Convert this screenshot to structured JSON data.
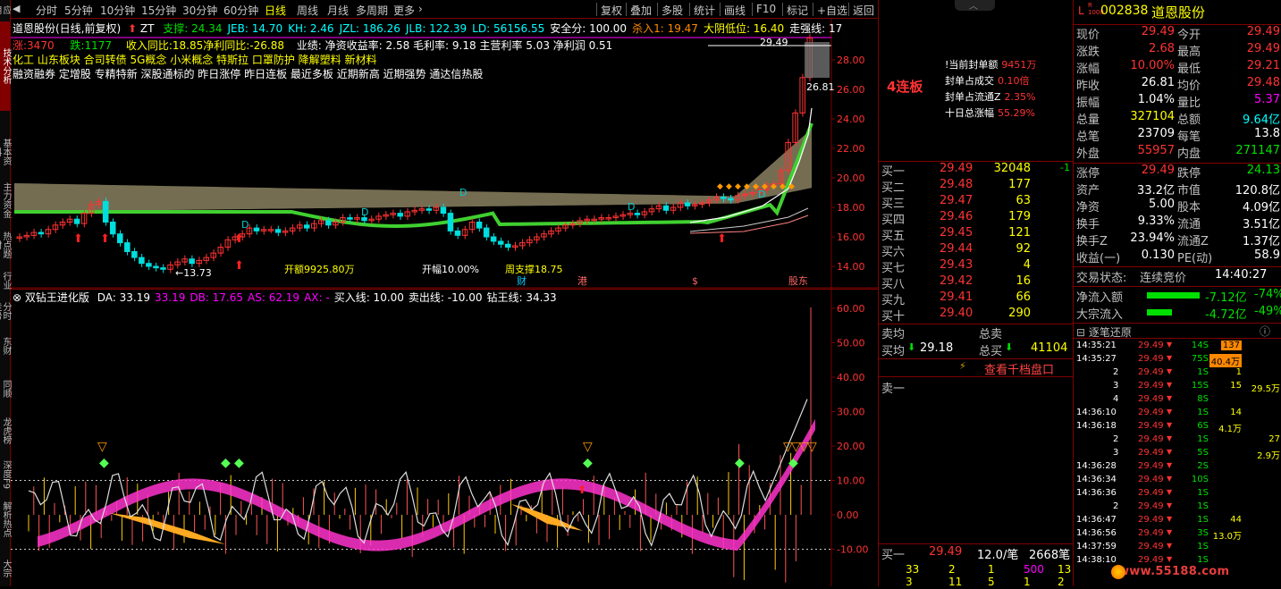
{
  "side_tabs": [
    "应用",
    "技术分析",
    "基本资料",
    "主力资金",
    "热点题材",
    "行业",
    "分时走势",
    "东财",
    "同顺",
    "龙虎榜",
    "深度F9",
    "解析热点",
    "大宗"
  ],
  "period_bar": {
    "periods": [
      "分时",
      "5分钟",
      "10分钟",
      "15分钟",
      "30分钟",
      "60分钟",
      "日线",
      "周线",
      "月线",
      "多周期",
      "更多"
    ],
    "more_arrow": "›",
    "active": "日线",
    "right_buttons": [
      "复权",
      "叠加",
      "多股",
      "统计",
      "画线",
      "F10",
      "标记",
      "+自选",
      "返回"
    ]
  },
  "kline": {
    "title": "道恩股份(日线,前复权)",
    "zt": "ZT",
    "indicators": [
      {
        "label": "支撑: 24.34",
        "color": "#00e000"
      },
      {
        "label": "JEB: 14.70",
        "color": "#00ffff"
      },
      {
        "label": "KH: 2.46",
        "color": "#00ffff"
      },
      {
        "label": "JZL: 186.26",
        "color": "#00ffff"
      },
      {
        "label": "JLB: 122.39",
        "color": "#00ffff"
      },
      {
        "label": "LD: 56156.55",
        "color": "#00ffff"
      },
      {
        "label": "安全分: 100.00",
        "color": "#ffffff"
      },
      {
        "label": "杀入1: 19.47",
        "color": "#ff8800"
      },
      {
        "label": "大阴低位: 16.40",
        "color": "#ffff00"
      },
      {
        "label": "走强线: 17",
        "color": "#ffffff"
      }
    ],
    "fund_line1": "涨:3470  跌:1177  收入同比:18.85净利同比:-26.88  业绩: 净资收益率: 2.58 毛利率: 9.18 主营利率 5.03 净利润 0.51",
    "rise": "涨:3470",
    "fall": "跌:1177",
    "fund_text": "收入同比:18.85净利同比:-26.88",
    "perf_text": "业绩: 净资收益率: 2.58 毛利率: 9.18 主营利率 5.03 净利润 0.51",
    "concepts_line": "化工          山东板块         合司转债 5G概念 小米概念 特斯拉 口罩防护 降解塑料 新材料",
    "tags_line": "融资融券 定增股 专精特新 深股通标的 昨日涨停 昨日连板 最近多板 近期新高 近期强势 通达信热股",
    "price_axis": [
      "28.00",
      "26.00",
      "24.00",
      "22.00",
      "20.00",
      "18.00",
      "16.00",
      "14.00"
    ],
    "annotations": {
      "low_price": "←13.73",
      "open_amount": "开额9925.80万",
      "open_pct": "开幅10.00%",
      "week_support": "周支撑18.75",
      "high_1": "29.49",
      "high_2": "26.81"
    },
    "bottom_marks": [
      "财",
      "港",
      "$",
      "股东"
    ]
  },
  "osc": {
    "title": "双钻王进化版",
    "values": [
      {
        "label": "DA: 33.19",
        "color": "#ffffff"
      },
      {
        "label": "33.19",
        "color": "#ff00ff"
      },
      {
        "label": "DB: 17.65",
        "color": "#ff00ff"
      },
      {
        "label": "AS: 62.19",
        "color": "#ff00ff"
      },
      {
        "label": "AX: -",
        "color": "#ff00ff"
      },
      {
        "label": "买入线: 10.00",
        "color": "#ffffff"
      },
      {
        "label": "卖出线: -10.00",
        "color": "#ffffff"
      },
      {
        "label": "钻王线: 34.33",
        "color": "#ffffff"
      }
    ],
    "axis": [
      "60.00",
      "50.00",
      "40.00",
      "30.00",
      "20.00",
      "10.00",
      "0.00",
      "-10.00"
    ]
  },
  "mid": {
    "limit_count": "4连板",
    "seal_info": [
      {
        "label": "!当前封单额",
        "value": "9451万"
      },
      {
        "label": "封单占成交",
        "value": "0.10倍"
      },
      {
        "label": "封单占流通Z",
        "value": "2.35%"
      },
      {
        "label": "十日总涨幅",
        "value": "55.29%"
      }
    ],
    "bids": [
      {
        "label": "买一",
        "price": "29.49",
        "vol": "32048",
        "chg": "-1"
      },
      {
        "label": "买二",
        "price": "29.48",
        "vol": "177",
        "chg": ""
      },
      {
        "label": "买三",
        "price": "29.47",
        "vol": "63",
        "chg": ""
      },
      {
        "label": "买四",
        "price": "29.46",
        "vol": "179",
        "chg": ""
      },
      {
        "label": "买五",
        "price": "29.45",
        "vol": "121",
        "chg": ""
      },
      {
        "label": "买六",
        "price": "29.44",
        "vol": "92",
        "chg": ""
      },
      {
        "label": "买七",
        "price": "29.43",
        "vol": "4",
        "chg": ""
      },
      {
        "label": "买八",
        "price": "29.42",
        "vol": "16",
        "chg": ""
      },
      {
        "label": "买九",
        "price": "29.41",
        "vol": "66",
        "chg": ""
      },
      {
        "label": "买十",
        "price": "29.40",
        "vol": "290",
        "chg": ""
      }
    ],
    "sell_avg_label": "卖均",
    "total_sell_label": "总卖",
    "buy_avg_label": "买均",
    "buy_avg": "29.18",
    "total_buy_label": "总买",
    "total_buy": "41104",
    "view_book": "查看千档盘口",
    "ask_label": "卖一",
    "bottom_label": "买一",
    "bottom_price": "29.49",
    "bottom_per": "12.0/笔",
    "bottom_count": "2668笔",
    "queue_row1": [
      "33",
      "2",
      "1",
      "500",
      "13"
    ],
    "queue_row2": [
      "3",
      "11",
      "5",
      "1",
      "2"
    ]
  },
  "quote": {
    "code": "002838",
    "name": "道恩股份",
    "rows": [
      {
        "l1": "现价",
        "v1": "29.49",
        "c1": "#ff3333",
        "l2": "今开",
        "v2": "29.49",
        "c2": "#ff3333"
      },
      {
        "l1": "涨跌",
        "v1": "2.68",
        "c1": "#ff3333",
        "l2": "最高",
        "v2": "29.49",
        "c2": "#ff3333"
      },
      {
        "l1": "涨幅",
        "v1": "10.00%",
        "c1": "#ff3333",
        "l2": "最低",
        "v2": "29.21",
        "c2": "#ff3333"
      },
      {
        "l1": "昨收",
        "v1": "26.81",
        "c1": "#ffffff",
        "l2": "均价",
        "v2": "29.48",
        "c2": "#ff3333"
      },
      {
        "l1": "振幅",
        "v1": "1.04%",
        "c1": "#ffffff",
        "l2": "量比",
        "v2": "5.37",
        "c2": "#ff00ff"
      },
      {
        "l1": "总量",
        "v1": "327104",
        "c1": "#ffff00",
        "l2": "总额",
        "v2": "9.64亿",
        "c2": "#00ffff"
      },
      {
        "l1": "总笔",
        "v1": "23709",
        "c1": "#ffffff",
        "l2": "每笔",
        "v2": "13.8",
        "c2": "#ffffff"
      },
      {
        "l1": "外盘",
        "v1": "55957",
        "c1": "#ff3333",
        "l2": "内盘",
        "v2": "271147",
        "c2": "#00e000"
      }
    ],
    "rows2": [
      {
        "l1": "涨停",
        "v1": "29.49",
        "c1": "#ff3333",
        "l2": "跌停",
        "v2": "24.13",
        "c2": "#00e000"
      },
      {
        "l1": "资产",
        "v1": "33.2亿",
        "c1": "#ffffff",
        "l2": "市值",
        "v2": "120.8亿",
        "c2": "#ffffff"
      },
      {
        "l1": "净资",
        "v1": "5.00",
        "c1": "#ffffff",
        "l2": "股本",
        "v2": "4.09亿",
        "c2": "#ffffff"
      },
      {
        "l1": "换手",
        "v1": "9.33%",
        "c1": "#ffffff",
        "l2": "流通",
        "v2": "3.51亿",
        "c2": "#ffffff"
      },
      {
        "l1": "换手Z",
        "v1": "23.94%",
        "c1": "#ffffff",
        "l2": "流通Z",
        "v2": "1.37亿",
        "c2": "#ffffff"
      },
      {
        "l1": "收益(一)",
        "v1": "0.130",
        "c1": "#ffffff",
        "l2": "PE(动)",
        "v2": "58.9",
        "c2": "#ffffff"
      }
    ],
    "trade_status_label": "交易状态:",
    "trade_status": "连续竞价",
    "trade_time": "14:40:27",
    "net_inflow_label": "净流入额",
    "net_inflow": "-7.12亿",
    "net_inflow_pct": "-74%",
    "block_inflow_label": "大宗流入",
    "block_inflow": "-4.72亿",
    "block_inflow_pct": "-49%",
    "ticks_title": "逐笔还原",
    "ticks": [
      {
        "t": "14:35:21",
        "p": "29.49",
        "v": "14S",
        "q": "137",
        "q2": ""
      },
      {
        "t": "14:35:27",
        "p": "29.49",
        "v": "75S",
        "q": "40.4万",
        "q2": ""
      },
      {
        "t": "2",
        "p": "29.49",
        "v": "1S",
        "q": "1",
        "q2": ""
      },
      {
        "t": "3",
        "p": "29.49",
        "v": "15S",
        "q": "15",
        "q2": "29.5万"
      },
      {
        "t": "4",
        "p": "29.49",
        "v": "8S",
        "q": "",
        "q2": ""
      },
      {
        "t": "14:36:10",
        "p": "29.49",
        "v": "1S",
        "q": "14",
        "q2": ""
      },
      {
        "t": "14:36:18",
        "p": "29.49",
        "v": "6S",
        "q": "4.1万",
        "q2": ""
      },
      {
        "t": "2",
        "p": "29.49",
        "v": "1S",
        "q": "",
        "q2": "27"
      },
      {
        "t": "3",
        "p": "29.49",
        "v": "5S",
        "q": "",
        "q2": "2.9万"
      },
      {
        "t": "14:36:28",
        "p": "29.49",
        "v": "2S",
        "q": "",
        "q2": ""
      },
      {
        "t": "14:36:34",
        "p": "29.49",
        "v": "10S",
        "q": "",
        "q2": ""
      },
      {
        "t": "14:36:36",
        "p": "29.49",
        "v": "1S",
        "q": "",
        "q2": ""
      },
      {
        "t": "2",
        "p": "29.49",
        "v": "1S",
        "q": "",
        "q2": ""
      },
      {
        "t": "14:36:47",
        "p": "29.49",
        "v": "1S",
        "q": "44",
        "q2": ""
      },
      {
        "t": "14:36:56",
        "p": "29.49",
        "v": "3S",
        "q": "13.0万",
        "q2": ""
      },
      {
        "t": "14:37:59",
        "p": "29.49",
        "v": "1S",
        "q": "",
        "q2": ""
      },
      {
        "t": "14:38:10",
        "p": "29.49",
        "v": "1S",
        "q": "",
        "q2": ""
      }
    ],
    "watermark": "www.55188.com"
  }
}
